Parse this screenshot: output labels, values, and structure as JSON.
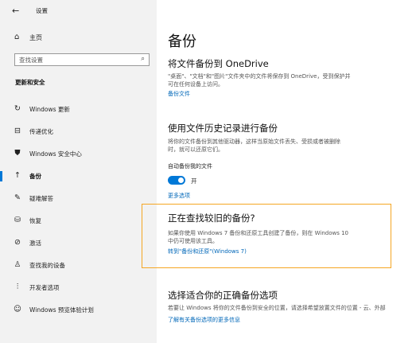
{
  "window": {
    "back_glyph": "←",
    "title": "设置"
  },
  "sidebar": {
    "home": {
      "icon": "home-icon",
      "glyph": "⌂",
      "label": "主页"
    },
    "search": {
      "placeholder": "查找设置",
      "icon": "search-icon",
      "glyph": "⌕"
    },
    "section_title": "更新和安全",
    "items": [
      {
        "icon": "refresh-icon",
        "glyph": "↻",
        "label": "Windows 更新"
      },
      {
        "icon": "delivery-optimization-icon",
        "glyph": "⊟",
        "label": "传递优化"
      },
      {
        "icon": "shield-icon",
        "glyph": "⛊",
        "label": "Windows 安全中心"
      },
      {
        "icon": "backup-icon",
        "glyph": "↑",
        "label": "备份",
        "active": true
      },
      {
        "icon": "wrench-icon",
        "glyph": "✎",
        "label": "疑难解答"
      },
      {
        "icon": "recovery-icon",
        "glyph": "⛁",
        "label": "恢复"
      },
      {
        "icon": "activation-icon",
        "glyph": "⊘",
        "label": "激活"
      },
      {
        "icon": "find-device-icon",
        "glyph": "♙",
        "label": "查找我的设备"
      },
      {
        "icon": "developer-icon",
        "glyph": "⫶",
        "label": "开发者选项"
      },
      {
        "icon": "insider-icon",
        "glyph": "☺",
        "label": "Windows 预览体验计划"
      }
    ]
  },
  "main": {
    "title": "备份",
    "onedrive": {
      "heading": "将文件备份到 OneDrive",
      "desc_line1": "\"桌面\"、\"文档\"和\"图片\"文件夹中的文件将保存到 OneDrive，受到保护并",
      "desc_line2": "可在任何设备上访问。",
      "link": "备份文件"
    },
    "history": {
      "heading": "使用文件历史记录进行备份",
      "desc_line1": "将你的文件备份到其他驱动器，这样当原始文件丢失、受损或者被删除",
      "desc_line2": "时，就可以还原它们。",
      "toggle_label": "自动备份我的文件",
      "toggle_state": "开",
      "more_link": "更多选项"
    },
    "older": {
      "heading": "正在查找较旧的备份?",
      "desc_line1": "如果你使用 Windows 7 备份和还原工具创建了备份，则在 Windows 10",
      "desc_line2": "中仍可使用该工具。",
      "link": "转到\"备份和还原\"(Windows 7)"
    },
    "choose": {
      "heading": "选择适合你的正确备份选项",
      "desc": "若要让 Windows 将你的文件备份到安全的位置，请选择希望放置文件的位置 - 云、外部",
      "link": "了解有关备份选项的更多信息"
    }
  },
  "colors": {
    "accent": "#0078d7",
    "link": "#0067b8",
    "highlight": "#f5a623",
    "sidebar_bg": "#f2f2f2"
  }
}
